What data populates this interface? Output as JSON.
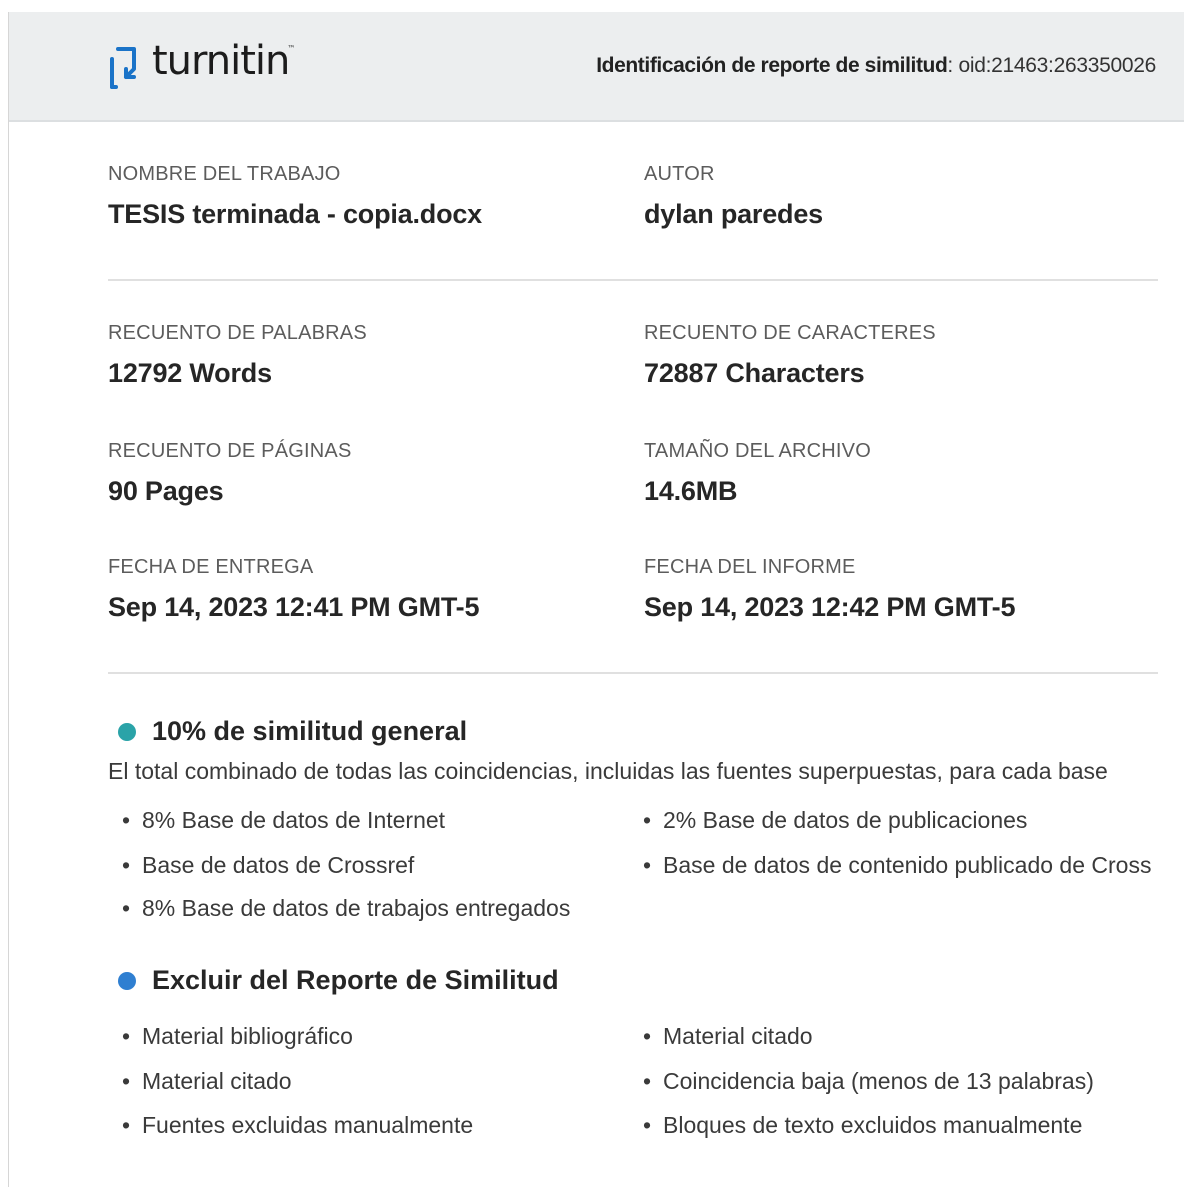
{
  "header": {
    "logo_text": "turnitin",
    "logo_tm": "™",
    "report_id_label": "Identificación de reporte de similitud",
    "report_id_value": ": oid:21463:263350026"
  },
  "details": {
    "job_name_label": "NOMBRE  DEL TRABAJO",
    "job_name_value": "TESIS terminada - copia.docx",
    "author_label": "AUTOR",
    "author_value": "dylan paredes",
    "word_count_label": "RECUENTO DE PALABRAS",
    "word_count_value": "12792 Words",
    "char_count_label": "RECUENTO  DE CARACTERES",
    "char_count_value": "72887 Characters",
    "page_count_label": "RECUENTO  DE PÁGINAS",
    "page_count_value": "90 Pages",
    "file_size_label": "TAMAÑO DEL ARCHIVO",
    "file_size_value": "14.6MB",
    "submission_date_label": "FECHA DE ENTREGA",
    "submission_date_value": "Sep 14, 2023 12:41 PM GMT-5",
    "report_date_label": "FECHA DEL INFORME",
    "report_date_value": "Sep 14, 2023 12:42 PM GMT-5"
  },
  "similarity": {
    "title": "10% de similitud general",
    "dot_color": "#2aa3a8",
    "description": "El total combinado de todas las coincidencias, incluidas las fuentes superpuestas, para cada base",
    "items": [
      "8% Base de datos de Internet",
      "2% Base de datos de publicaciones",
      "Base de datos de Crossref",
      "Base de datos de contenido publicado de Cross",
      "8% Base de datos de trabajos entregados"
    ]
  },
  "exclusions": {
    "title": "Excluir  del Reporte de Similitud",
    "dot_color": "#2f7fd1",
    "items": [
      "Material bibliográfico",
      "Material citado",
      "Material citado",
      "Coincidencia baja (menos de 13 palabras)",
      "Fuentes excluidas manualmente",
      "Bloques de texto excluidos manualmente"
    ]
  },
  "colors": {
    "header_bg": "#eceeef",
    "logo_blue": "#1a73c8",
    "text_dark": "#262626",
    "text_label": "#5c5c5c"
  }
}
